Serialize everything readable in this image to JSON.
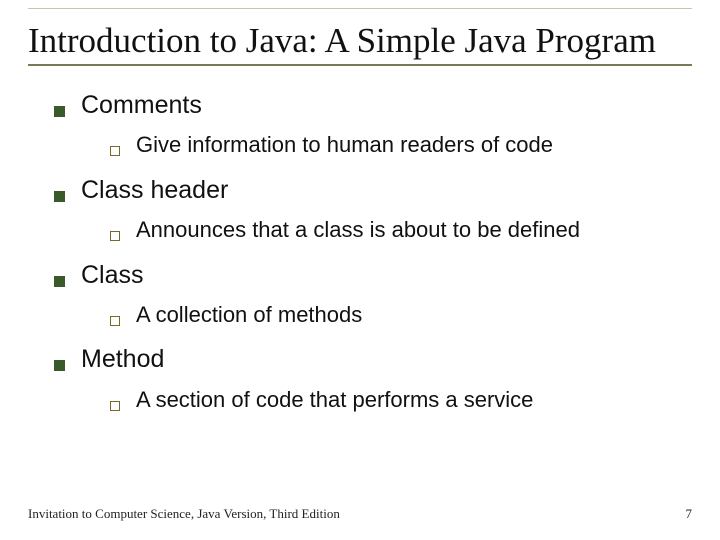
{
  "title": "Introduction to Java: A Simple Java Program",
  "items": [
    {
      "label": "Comments",
      "sub": "Give information to human readers of code"
    },
    {
      "label": "Class header",
      "sub": "Announces that a class is about to be defined"
    },
    {
      "label": "Class",
      "sub": "A collection of methods"
    },
    {
      "label": "Method",
      "sub": "A section of code that performs a service"
    }
  ],
  "footer": {
    "left": "Invitation to Computer Science, Java Version, Third Edition",
    "page": "7"
  }
}
